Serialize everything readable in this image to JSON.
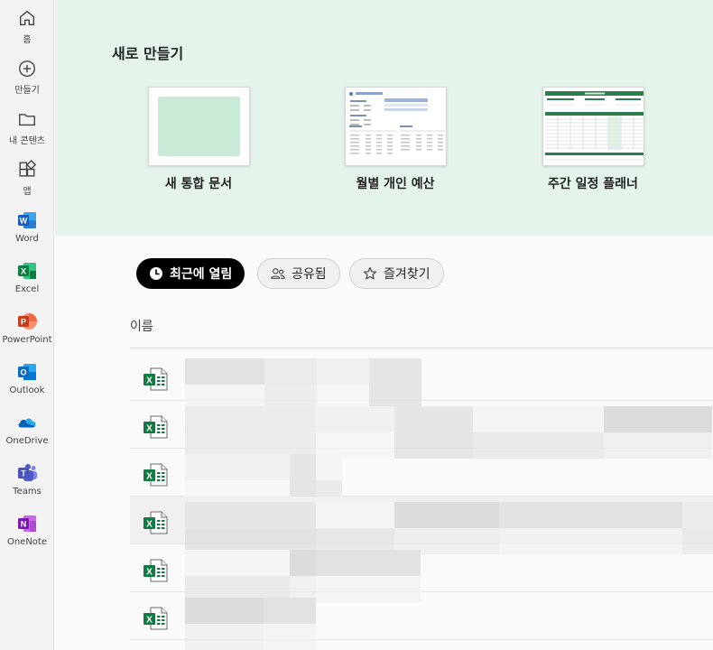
{
  "sidebar": {
    "items": [
      {
        "label": "홈",
        "icon": "home-icon"
      },
      {
        "label": "만들기",
        "icon": "add-circle-icon"
      },
      {
        "label": "내 콘텐츠",
        "icon": "folder-icon"
      },
      {
        "label": "앱",
        "icon": "apps-icon"
      },
      {
        "label": "Word",
        "icon": "word-icon",
        "color": "#185abd"
      },
      {
        "label": "Excel",
        "icon": "excel-icon",
        "color": "#107c41"
      },
      {
        "label": "PowerPoint",
        "icon": "powerpoint-icon",
        "color": "#c43e1c"
      },
      {
        "label": "Outlook",
        "icon": "outlook-icon",
        "color": "#0f6cbd"
      },
      {
        "label": "OneDrive",
        "icon": "onedrive-icon",
        "color": "#0364b8"
      },
      {
        "label": "Teams",
        "icon": "teams-icon",
        "color": "#5059c9"
      },
      {
        "label": "OneNote",
        "icon": "onenote-icon",
        "color": "#7719aa"
      }
    ]
  },
  "create": {
    "title": "새로 만들기",
    "background": "#e5f4ea",
    "templates": [
      {
        "label": "새 통합 문서"
      },
      {
        "label": "월별 개인 예산"
      },
      {
        "label": "주간 일정 플래너"
      }
    ]
  },
  "filters": {
    "recent": "최근에 열림",
    "shared": "공유됨",
    "favorites": "즐겨찾기"
  },
  "list": {
    "column_name": "이름",
    "row_count": 6,
    "file_icon": "excel-file-icon",
    "names_redacted": true
  },
  "colors": {
    "excel_green": "#107c41",
    "active_pill": "#000000"
  }
}
